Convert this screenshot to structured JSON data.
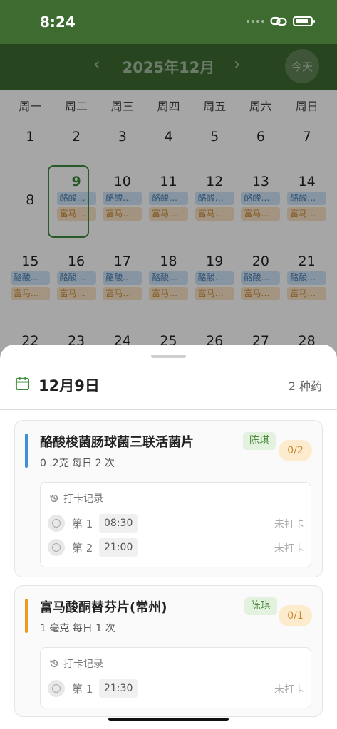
{
  "status_bar": {
    "time": "8:24"
  },
  "calendar": {
    "month_title": "2025年12月",
    "prev_symbol": "‹",
    "next_symbol": "›",
    "today_label": "今天",
    "weekdays": [
      "周一",
      "周二",
      "周三",
      "周四",
      "周五",
      "周六",
      "周日"
    ],
    "weeks": [
      [
        "1",
        "2",
        "3",
        "4",
        "5",
        "6",
        "7"
      ],
      [
        "8",
        "9",
        "10",
        "11",
        "12",
        "13",
        "14"
      ],
      [
        "15",
        "16",
        "17",
        "18",
        "19",
        "20",
        "21"
      ],
      [
        "22",
        "23",
        "24",
        "25",
        "26",
        "27",
        "28"
      ]
    ],
    "chip_blue": "酪酸…",
    "chip_orange": "富马…",
    "selected_day": "9"
  },
  "sheet": {
    "date": "12月9日",
    "med_count": "2 种药",
    "meds": [
      {
        "name": "酪酸梭菌肠球菌三联活菌片",
        "dosage": "0 .2克   每日 2 次",
        "patient": "陈琪",
        "progress": "0/2",
        "bar_color": "#3d8fd8",
        "record_title": "打卡记录",
        "records": [
          {
            "label": "第 1",
            "time": "08:30",
            "status": "未打卡"
          },
          {
            "label": "第 2",
            "time": "21:00",
            "status": "未打卡"
          }
        ]
      },
      {
        "name": "富马酸酮替芬片(常州)",
        "dosage": "1 毫克   每日 1 次",
        "patient": "陈琪",
        "progress": "0/1",
        "bar_color": "#f09a1c",
        "record_title": "打卡记录",
        "records": [
          {
            "label": "第 1",
            "time": "21:30",
            "status": "未打卡"
          }
        ]
      }
    ]
  },
  "colors": {
    "header_green": "#3d6b30",
    "accent_green": "#3d8b3d",
    "chip_blue": "#cfe4f7",
    "chip_orange": "#fbe3c6"
  }
}
